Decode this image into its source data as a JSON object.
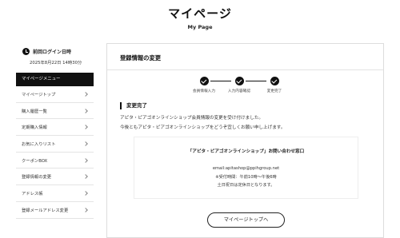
{
  "header": {
    "title": "マイページ",
    "subtitle": "My Page"
  },
  "sidebar": {
    "last_login_title": "前回ログイン日時",
    "last_login_time": "2025年8月22日 14時30分",
    "menu_header": "マイページメニュー",
    "items": [
      {
        "label": "マイページトップ",
        "icon": "chevron-right-icon"
      },
      {
        "label": "購入履歴一覧",
        "icon": "chevron-right-icon"
      },
      {
        "label": "定期購入情報",
        "icon": "chevron-right-icon"
      },
      {
        "label": "お気に入りリスト",
        "icon": "chevron-right-icon"
      },
      {
        "label": "クーポンBOX",
        "icon": "chevron-right-icon"
      },
      {
        "label": "登録情報の変更",
        "icon": "chevron-right-icon"
      },
      {
        "label": "アドレス帳",
        "icon": "chevron-right-icon"
      },
      {
        "label": "登録メールアドレス変更",
        "icon": "chevron-right-icon"
      }
    ]
  },
  "main": {
    "title": "登録情報の変更",
    "steps": [
      {
        "label": "会員情報入力",
        "done": true
      },
      {
        "label": "入力内容確認",
        "done": true
      },
      {
        "label": "変更完了",
        "done": true
      }
    ],
    "section_heading": "変更完了",
    "message_line1": "アピタ・ピアゴオンラインショップ会員情報の変更を受け付けました。",
    "message_line2": "今後ともアピタ・ピアゴオンラインショップをどうぞ宜しくお願い申し上げます。",
    "contact": {
      "title": "「アピタ・ピアゴオンラインショップ」お問い合わせ窓口",
      "email": "email:apitashop@ppihgroup.net",
      "hours": "※受付時間：午前10時〜午後6時",
      "closed": "土日祝日は定休日となります。"
    },
    "top_button_label": "マイページトップへ"
  },
  "colors": {
    "accent": "#111111",
    "border": "#e4e4e4"
  }
}
